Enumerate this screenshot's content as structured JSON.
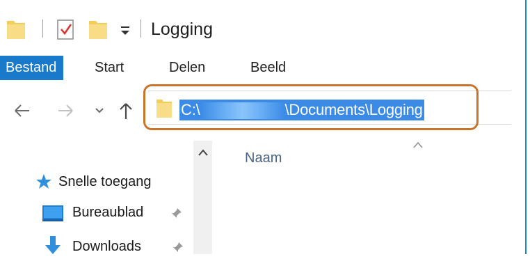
{
  "window": {
    "title": "Logging",
    "quick_access": [
      "folder-icon",
      "properties-check-icon",
      "new-folder-icon",
      "customize-dropdown-icon"
    ]
  },
  "ribbon": {
    "tabs": [
      {
        "label": "Bestand",
        "active": true
      },
      {
        "label": "Start"
      },
      {
        "label": "Delen"
      },
      {
        "label": "Beeld"
      }
    ]
  },
  "address_bar": {
    "path_prefix": "C:\\",
    "path_suffix": "\\Documents\\Logging"
  },
  "sidebar": {
    "items": [
      {
        "label": "Snelle toegang",
        "icon": "star-icon"
      },
      {
        "label": "Bureaublad",
        "icon": "desktop-icon",
        "pinned": true
      },
      {
        "label": "Downloads",
        "icon": "download-arrow-icon",
        "pinned": true
      }
    ]
  },
  "content": {
    "column_header": "Naam"
  },
  "colors": {
    "accent": "#1979ca",
    "selection": "#3a8ae6",
    "highlight_outline": "#c8742a",
    "folder": "#f5d36b"
  }
}
